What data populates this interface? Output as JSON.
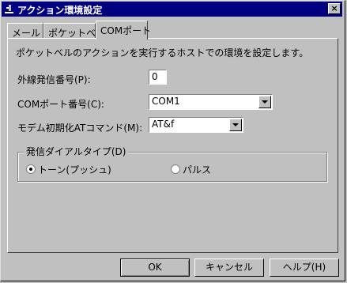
{
  "window": {
    "title": "アクション環境設定",
    "close_symbol": "×"
  },
  "tabs": [
    {
      "label": "メール"
    },
    {
      "label": "ポケットベル"
    },
    {
      "label": "COMポート"
    }
  ],
  "panel": {
    "description": "ポケットベルのアクションを実行するホストでの環境を設定します。",
    "outside_line": {
      "label": "外線発信番号(P):",
      "value": "0"
    },
    "com_port": {
      "label": "COMポート番号(C):",
      "value": "COM1"
    },
    "modem": {
      "label": "モデム初期化ATコマンド(M):",
      "value": "AT&f"
    },
    "dial_type": {
      "title": "発信ダイアルタイプ(D)",
      "options": [
        {
          "label": "トーン(プッシュ)",
          "selected": true
        },
        {
          "label": "パルス",
          "selected": false
        }
      ]
    }
  },
  "buttons": {
    "ok": "OK",
    "cancel": "キャンセル",
    "help": "ヘルプ(H)"
  }
}
